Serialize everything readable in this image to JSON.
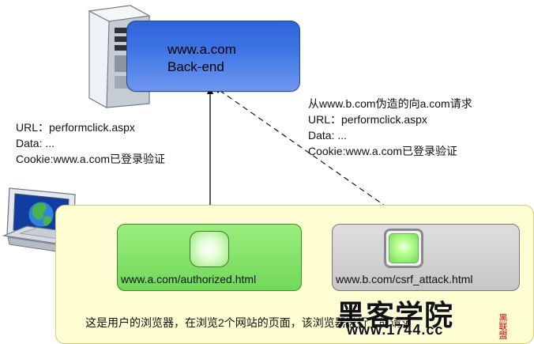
{
  "backend": {
    "line1": "www.a.com",
    "line2": "Back-end"
  },
  "request_left": {
    "line1": "URL：performclick.aspx",
    "line2": "Data: ...",
    "line3": "Cookie:www.a.com已登录验证"
  },
  "request_right": {
    "line1": "从www.b.com伪造的向a.com请求",
    "line2": "URL：performclick.aspx",
    "line3": "Data: ...",
    "line4": "Cookie:www.a.com已登录验证"
  },
  "page_a": {
    "label": "www.a.com/authorized.html"
  },
  "page_b": {
    "label": "www.b.com/csrf_attack.html"
  },
  "caption": "这是用户的浏览器，在浏览2个网站的页面，该浏览器进行了的请求",
  "watermark": {
    "title": "黑客学院",
    "subtitle": "www.1744.cc",
    "brand": "黑联盟"
  }
}
